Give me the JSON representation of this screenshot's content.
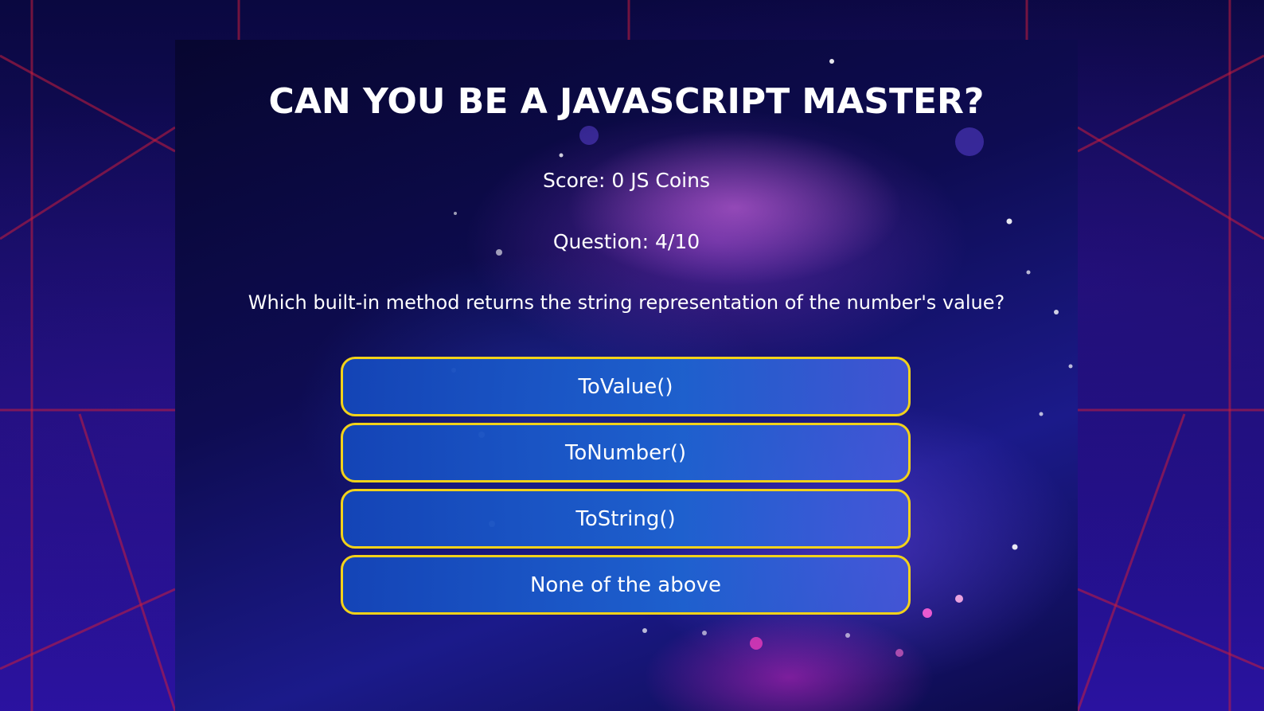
{
  "game": {
    "title": "CAN YOU BE A JAVASCRIPT MASTER?",
    "score_text": "Score: 0 JS Coins",
    "question_counter": "Question: 4/10",
    "question": "Which built-in method returns the string representation of the number's value?",
    "answers": [
      {
        "label": "ToValue()"
      },
      {
        "label": "ToNumber()"
      },
      {
        "label": "ToString()"
      },
      {
        "label": "None of the above"
      }
    ]
  },
  "colors": {
    "answer_border": "#f2d21a",
    "answer_fill": "#1e64d2",
    "text": "#ffffff"
  }
}
